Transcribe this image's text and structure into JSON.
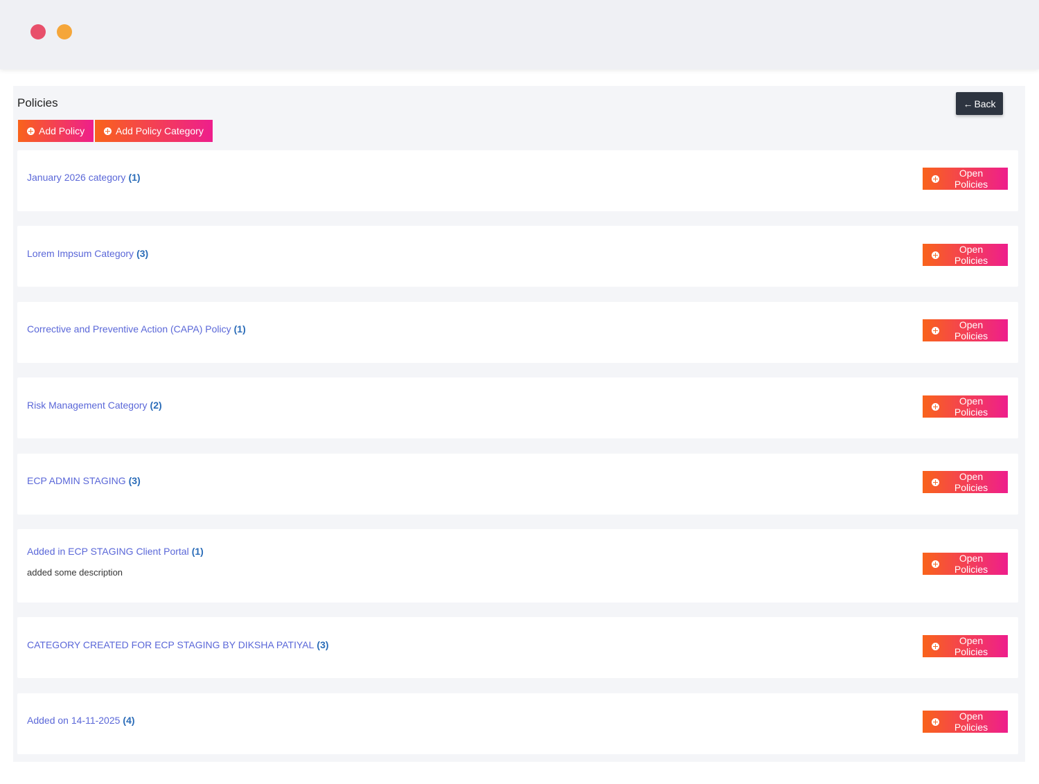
{
  "header": {
    "dots": [
      {
        "name": "red-dot",
        "color": "#e8506b"
      },
      {
        "name": "orange-dot",
        "color": "#f5a63a"
      }
    ]
  },
  "page": {
    "title": "Policies",
    "back_label": "Back",
    "add_policy_label": "Add Policy",
    "add_category_label": "Add Policy Category"
  },
  "colors": {
    "button_gradient_start": "#f9631b",
    "button_gradient_end": "#ee1e8c",
    "category_title": "#5a67d8",
    "count": "#2a6cb8"
  },
  "categories": [
    {
      "title": "January 2026 category",
      "count": "(1)",
      "description": "",
      "button": "Open Policies"
    },
    {
      "title": "Lorem Impsum Category",
      "count": "(3)",
      "description": "",
      "button": "Open Policies"
    },
    {
      "title": "Corrective and Preventive Action (CAPA) Policy",
      "count": "(1)",
      "description": "",
      "button": "Open Policies"
    },
    {
      "title": "Risk Management Category",
      "count": "(2)",
      "description": "",
      "button": "Open Policies"
    },
    {
      "title": "ECP ADMIN STAGING",
      "count": "(3)",
      "description": "",
      "button": "Open Policies"
    },
    {
      "title": "Added in ECP STAGING Client Portal",
      "count": "(1)",
      "description": "added some description",
      "button": "Open Policies"
    },
    {
      "title": "CATEGORY CREATED FOR ECP STAGING BY DIKSHA PATIYAL",
      "count": "(3)",
      "description": "",
      "button": "Open Policies"
    },
    {
      "title": "Added on 14-11-2025",
      "count": "(4)",
      "description": "",
      "button": "Open Policies"
    }
  ]
}
